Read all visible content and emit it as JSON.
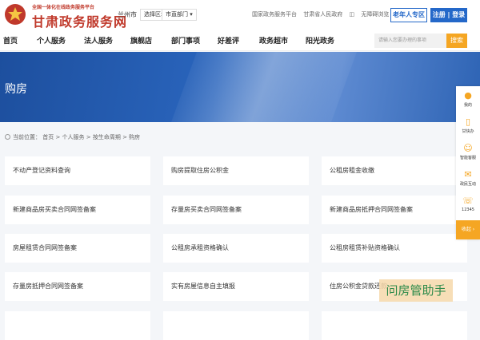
{
  "header": {
    "logo_icon": "emblem-icon",
    "logo_sub": "全国一体化在线政务服务平台",
    "logo_main": "甘肃政务服务网",
    "city": "兰州市",
    "region_select": "选择区域",
    "dept_select": "市直部门",
    "links": [
      "国家政务服务平台",
      "甘肃省人民政府",
      "无障碍浏览"
    ],
    "elder_button": "老年人专区",
    "login_button": "注册 | 登录"
  },
  "nav": {
    "items": [
      "首页",
      "个人服务",
      "法人服务",
      "旗舰店",
      "部门事项",
      "好差评",
      "政务超市",
      "阳光政务"
    ],
    "search_placeholder": "请输入您要办理的事项",
    "search_button": "搜索"
  },
  "banner": {
    "title": "购房"
  },
  "breadcrumb": {
    "text": "当前位置：  首页 > 个人服务 > 按生命周期 > 购房"
  },
  "services": [
    "不动产登记资料查询",
    "购房提取住房公积金",
    "公租房租金收缴",
    "新建商品房买卖合同网签备案",
    "存量房买卖合同网签备案",
    "新建商品房抵押合同网签备案",
    "房屋租赁合同网签备案",
    "公租房承租资格确认",
    "公租房租赁补贴资格确认",
    "存量房抵押合同网签备案",
    "实有房屋信息自主填报",
    "住房公积金贷款还款",
    "",
    "",
    ""
  ],
  "sidebar": {
    "items": [
      {
        "icon": "person-icon",
        "label": "我的"
      },
      {
        "icon": "phone-icon",
        "label": "甘快办"
      },
      {
        "icon": "robot-icon",
        "label": "智能客服"
      },
      {
        "icon": "message-icon",
        "label": "政民互动"
      },
      {
        "icon": "headset-icon",
        "label": "12345"
      }
    ],
    "collapse": "收起"
  },
  "watermark": "问房管助手",
  "colors": {
    "brand_red": "#c0392b",
    "primary_blue": "#2468c9",
    "accent_orange": "#f5a623"
  }
}
